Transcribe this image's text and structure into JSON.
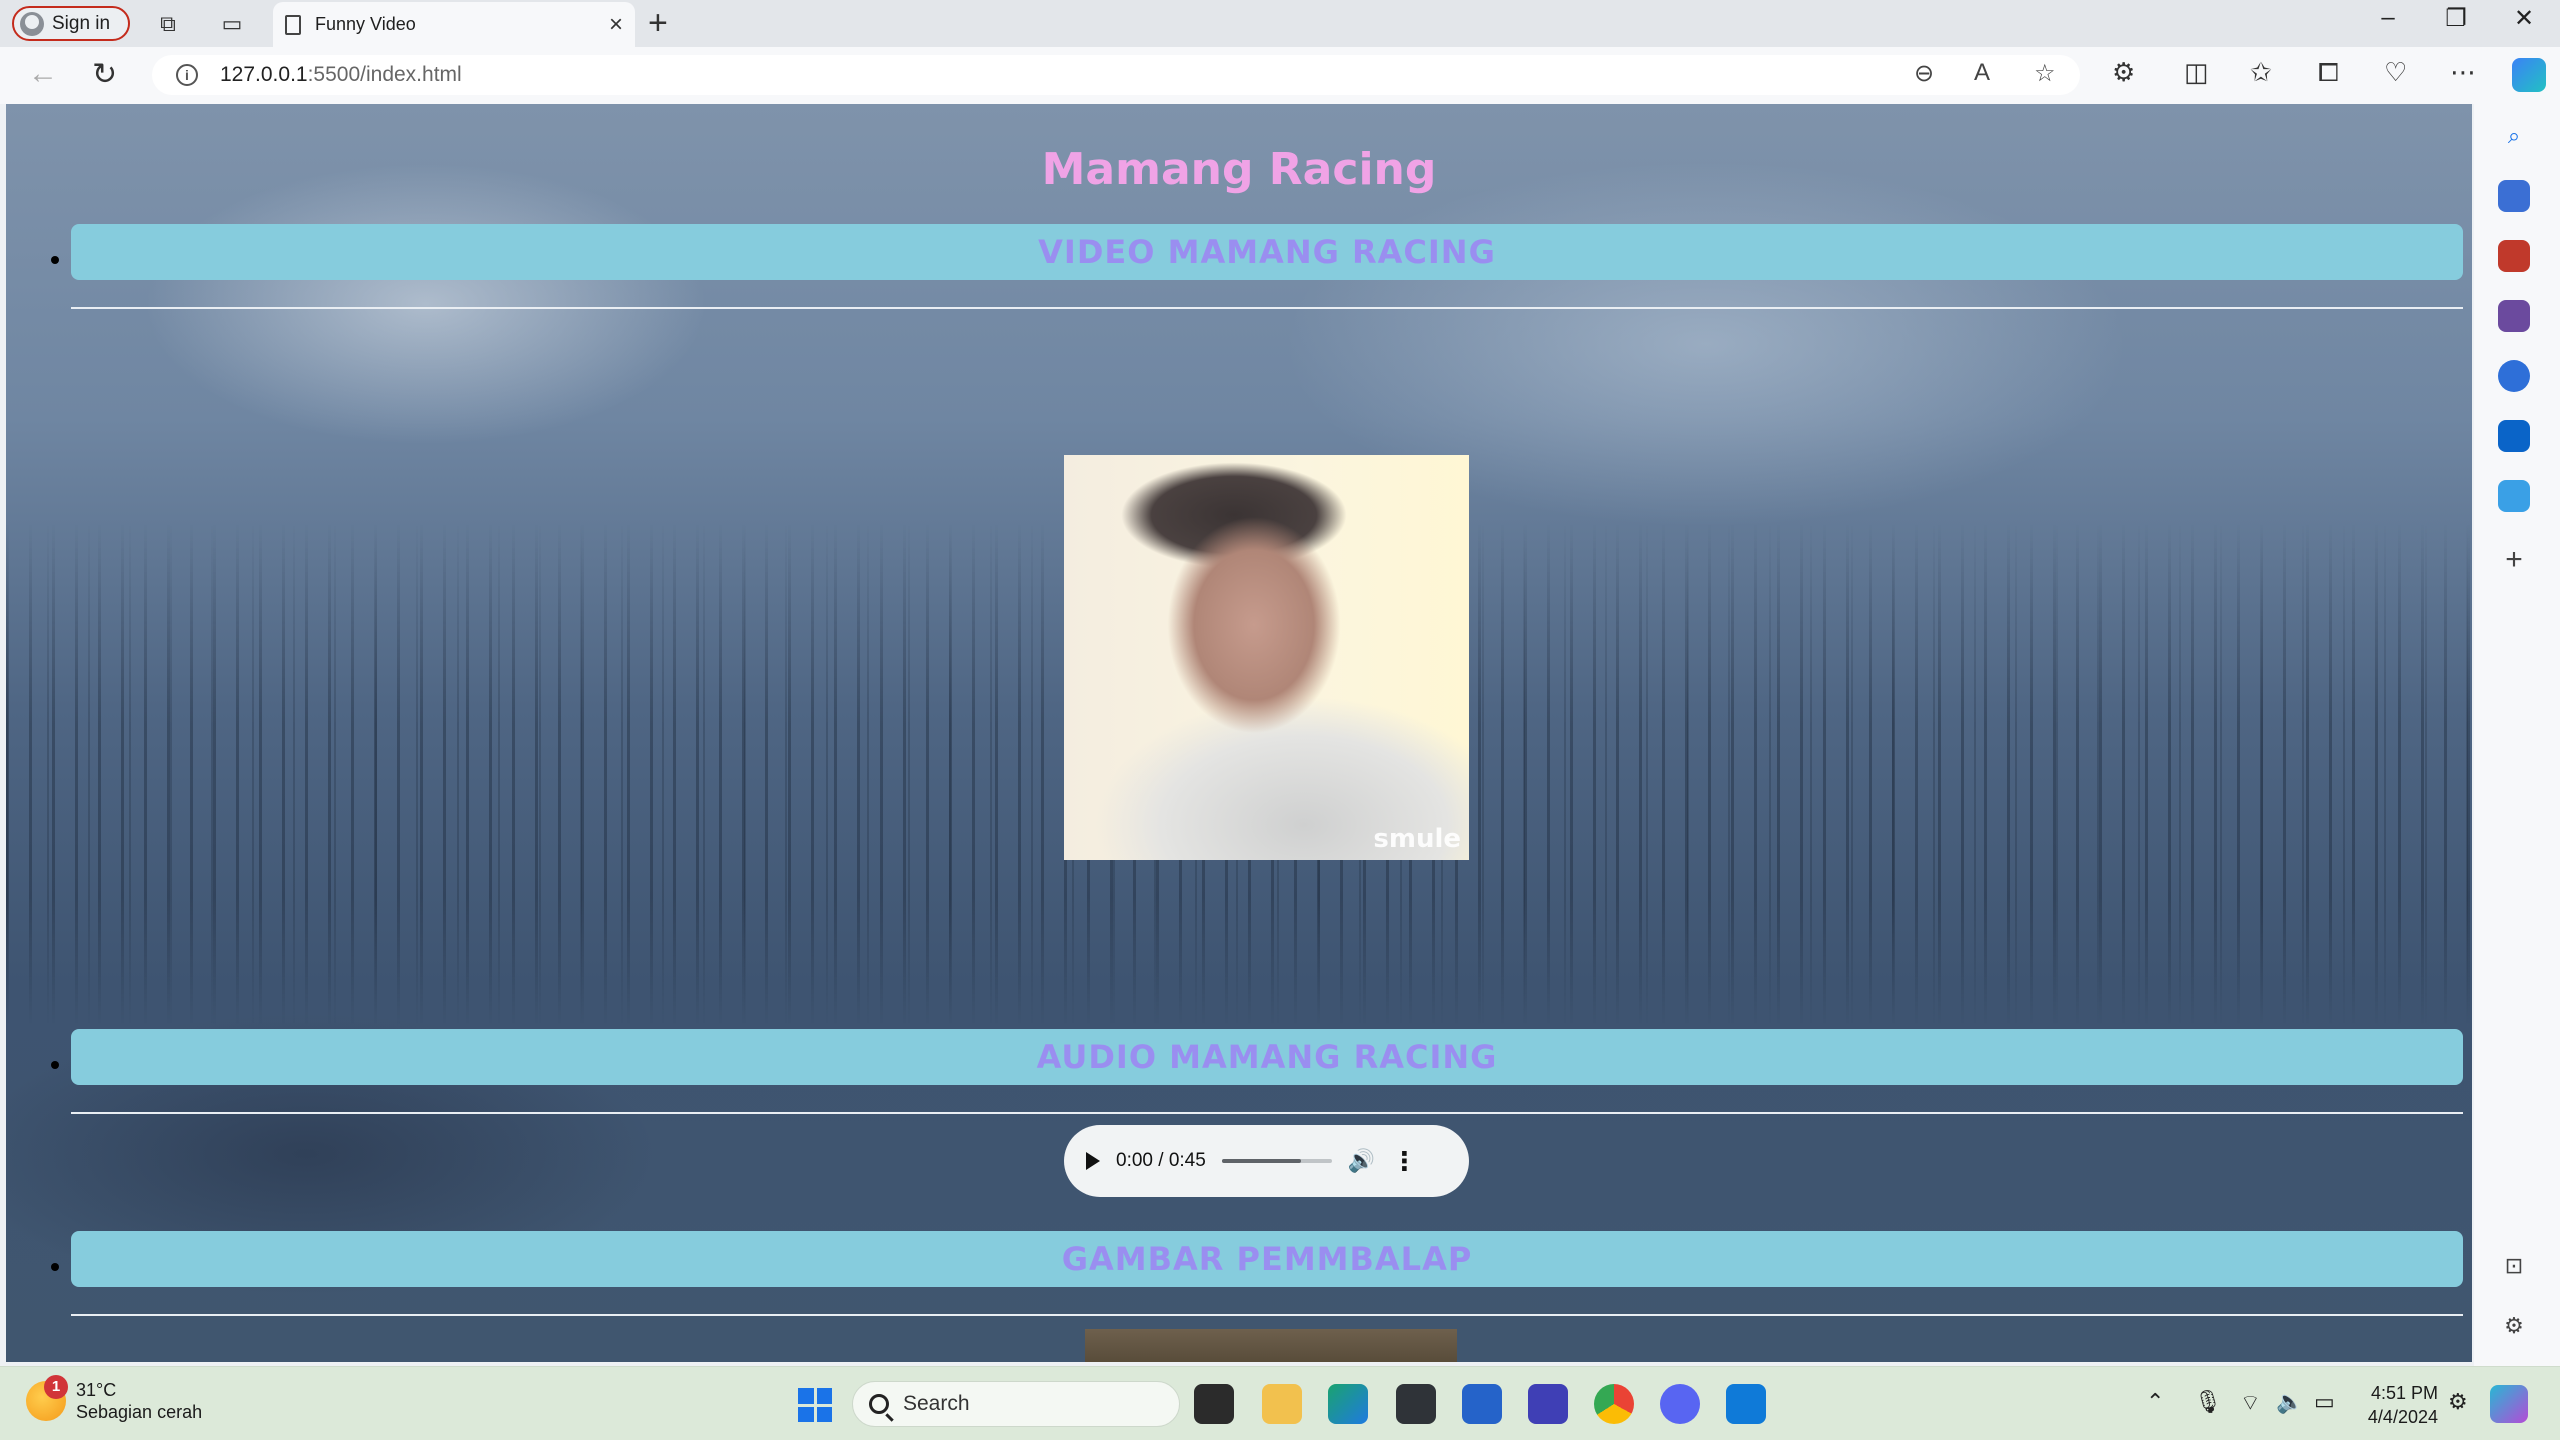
{
  "browser": {
    "signin_label": "Sign in",
    "tab_title": "Funny Video",
    "url_host": "127.0.0.1",
    "url_rest": ":5500/index.html"
  },
  "page": {
    "title": "Mamang Racing",
    "sections": [
      {
        "heading": "VIDEO MAMANG RACING"
      },
      {
        "heading": "AUDIO MAMANG RACING"
      },
      {
        "heading": "GAMBAR PEMMBALAP"
      }
    ],
    "video": {
      "watermark": "smule"
    },
    "audio": {
      "time": "0:00 / 0:45",
      "volume_level": 0.72
    }
  },
  "taskbar": {
    "weather_temp": "31°C",
    "weather_desc": "Sebagian cerah",
    "weather_badge": "1",
    "search_label": "Search",
    "time": "4:51 PM",
    "date": "4/4/2024"
  },
  "colors": {
    "title": "#f0a3e6",
    "section_bg": "#86ccdd",
    "section_text": "#9a8ef0"
  }
}
